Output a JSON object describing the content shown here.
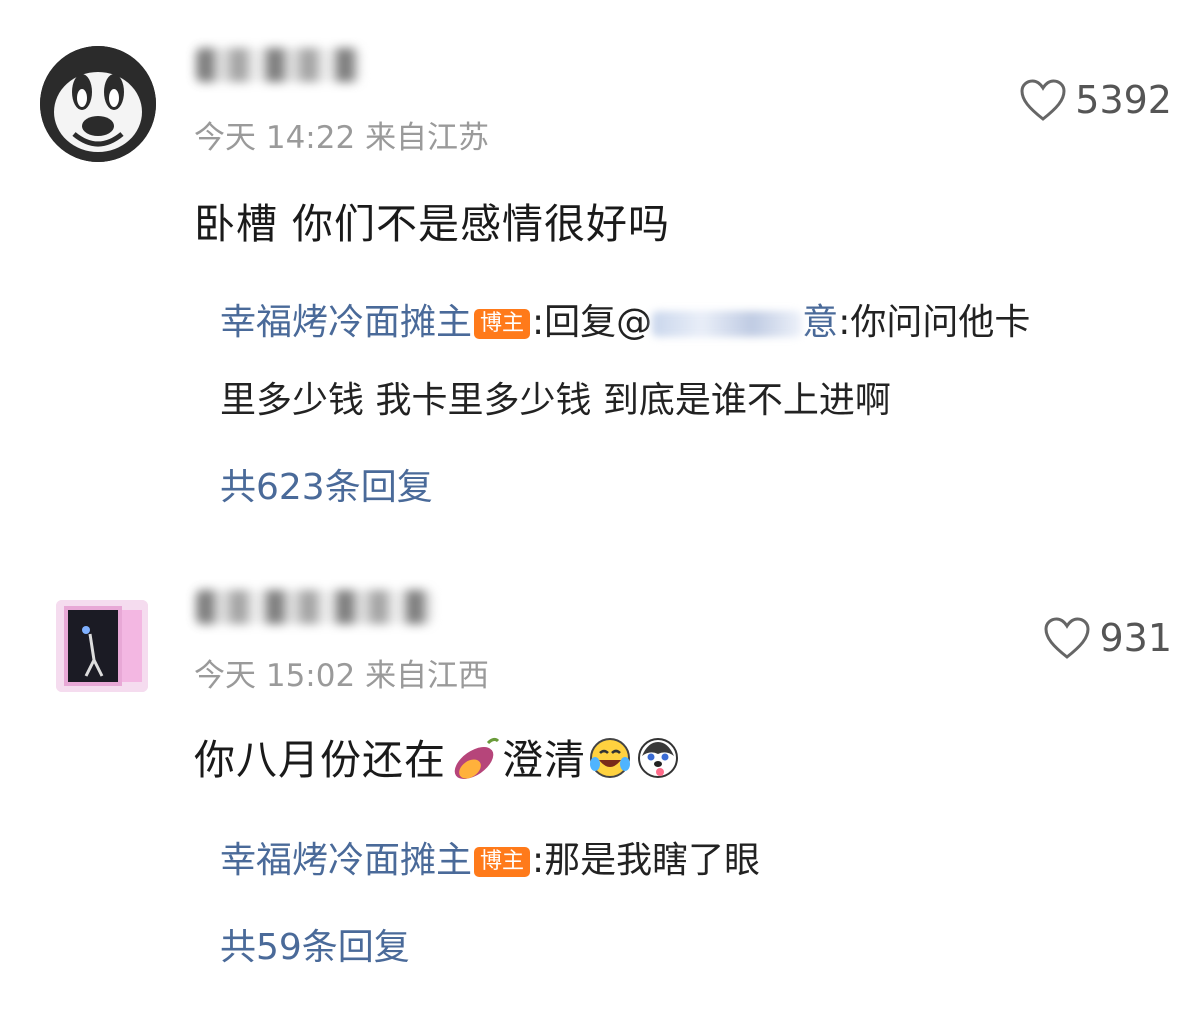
{
  "comments": [
    {
      "time": "今天 14:22",
      "location": "来自江苏",
      "likes": "5392",
      "text": "卧槽 你们不是感情很好吗",
      "reply": {
        "author": "幸福烤冷面摊主",
        "badge": "博主",
        "prefix": ":回复@",
        "mention_tail": "意",
        "body_first": ":你问问他卡",
        "body_second": "里多少钱 我卡里多少钱 到底是谁不上进啊"
      },
      "more_replies": "共623条回复"
    },
    {
      "time": "今天 15:02",
      "location": "来自江西",
      "likes": "931",
      "text_before": "你八月份还在",
      "text_after": "澄清",
      "emojis": [
        "sweet-potato-icon",
        "laugh-cry-icon",
        "husky-icon"
      ],
      "reply": {
        "author": "幸福烤冷面摊主",
        "badge": "博主",
        "body": ":那是我瞎了眼"
      },
      "more_replies": "共59条回复"
    }
  ],
  "colors": {
    "link": "#4a6a99",
    "meta": "#9a9a9a",
    "badge": "#ff7a1a"
  }
}
